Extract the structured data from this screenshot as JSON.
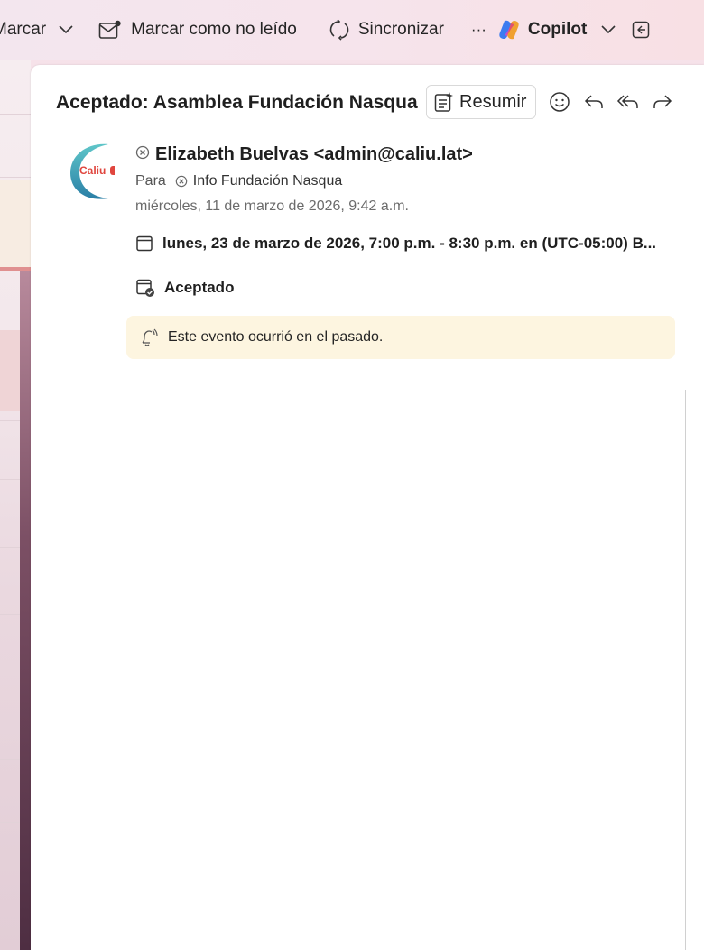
{
  "toolbar": {
    "marcar_label": "Marcar",
    "mark_unread_label": "Marcar como no leído",
    "sync_label": "Sincronizar",
    "more_label": "···",
    "copilot_label": "Copilot"
  },
  "email": {
    "subject": "Aceptado: Asamblea Fundación Nasqua",
    "summarize_label": "Resumir",
    "avatar_text": "Caliu",
    "sender": "Elizabeth Buelvas <admin@caliu.lat>",
    "to_prefix": "Para",
    "to_recipient": "Info Fundación Nasqua",
    "date": "miércoles, 11 de marzo de 2026, 9:42 a.m."
  },
  "event": {
    "when": "lunes, 23 de marzo de 2026, 7:00 p.m. - 8:30 p.m. en (UTC-05:00) B...",
    "status": "Aceptado",
    "notice": "Este evento ocurrió en el pasado."
  },
  "colors": {
    "accent_teal": "#2e8fa0",
    "logo_red": "#e0463e",
    "notice_bg": "#fdf5e0"
  }
}
